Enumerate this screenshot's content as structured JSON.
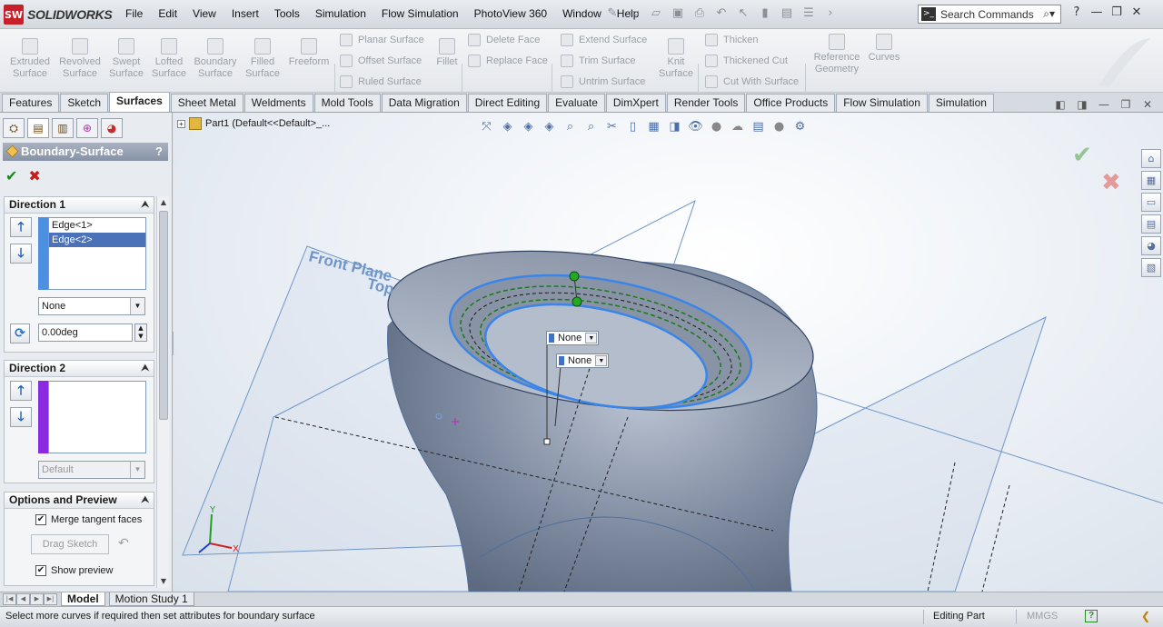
{
  "app": {
    "brand": "SOLIDWORKS",
    "logo_text": "SW"
  },
  "menu": [
    "File",
    "Edit",
    "View",
    "Insert",
    "Tools",
    "Simulation",
    "Flow Simulation",
    "PhotoView 360",
    "Window",
    "Help"
  ],
  "search": {
    "placeholder": "Search Commands"
  },
  "ribbon": {
    "large": [
      {
        "label": "Extruded\nSurface"
      },
      {
        "label": "Revolved\nSurface"
      },
      {
        "label": "Swept\nSurface"
      },
      {
        "label": "Lofted\nSurface"
      },
      {
        "label": "Boundary\nSurface"
      },
      {
        "label": "Filled\nSurface"
      },
      {
        "label": "Freeform"
      }
    ],
    "col1": [
      "Planar Surface",
      "Offset Surface",
      "Ruled Surface"
    ],
    "fillet": "Fillet",
    "col2": [
      "Delete Face",
      "Replace Face"
    ],
    "col3": [
      "Extend Surface",
      "Trim Surface",
      "Untrim Surface"
    ],
    "knit": "Knit\nSurface",
    "col4": [
      "Thicken",
      "Thickened Cut",
      "Cut With Surface"
    ],
    "refgeo": "Reference\nGeometry",
    "curves": "Curves"
  },
  "tabs": [
    "Features",
    "Sketch",
    "Surfaces",
    "Sheet Metal",
    "Weldments",
    "Mold Tools",
    "Data Migration",
    "Direct Editing",
    "Evaluate",
    "DimXpert",
    "Render Tools",
    "Office Products",
    "Flow Simulation",
    "Simulation"
  ],
  "active_tab": "Surfaces",
  "property_manager": {
    "title": "Boundary-Surface",
    "help": "?",
    "direction1": {
      "header": "Direction 1",
      "items": [
        "Edge<1>",
        "Edge<2>"
      ],
      "selected": "Edge<2>",
      "tangency": "None",
      "angle": "0.00deg",
      "color": "#4d90e0"
    },
    "direction2": {
      "header": "Direction 2",
      "items": [],
      "tangency": "Default",
      "color": "#8a2be2"
    },
    "options": {
      "header": "Options and Preview",
      "merge_tangent": "Merge tangent faces",
      "merge_checked": true,
      "drag_sketch": "Drag Sketch",
      "show_preview": "Show preview",
      "preview_checked": true
    }
  },
  "tree": {
    "label": "Part1  (Default<<Default>_..."
  },
  "viewport": {
    "plane_front": "Front Plane",
    "plane_top": "Top",
    "callout1": "None",
    "callout2": "None",
    "axis_x": "X",
    "axis_y": "Y"
  },
  "bottom_tabs": [
    "Model",
    "Motion Study 1"
  ],
  "active_bottom_tab": "Model",
  "status": {
    "message": "Select more curves if required then set attributes for boundary surface",
    "editing": "Editing Part",
    "units": "MMGS",
    "help": "?"
  }
}
